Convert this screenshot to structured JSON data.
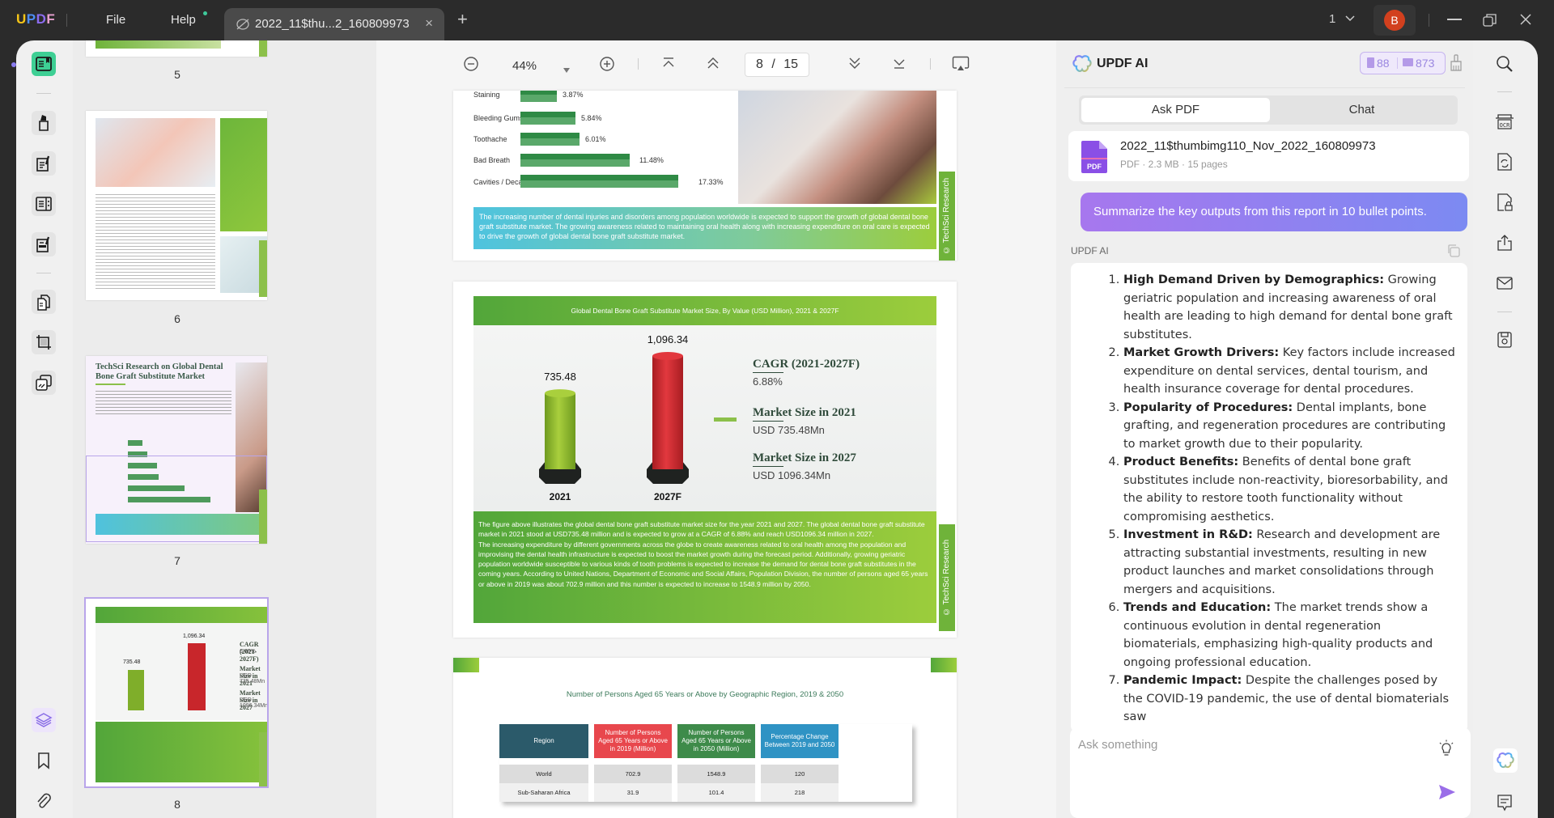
{
  "titlebar": {
    "app_name": "UPDF",
    "menus": [
      "File",
      "Help"
    ],
    "tab_title": "2022_11$thu...2_160809973",
    "close_tab": "×",
    "new_tab": "+",
    "window_count": "1",
    "avatar_initial": "B"
  },
  "left_toolbar": {
    "tools": [
      "reader-icon",
      "highlighter-icon",
      "edit-pdf-icon",
      "organize-pages-icon",
      "fill-sign-icon",
      "page-tools-icon",
      "crop-icon",
      "watermark-icon"
    ],
    "bottom": [
      "layers-icon",
      "bookmark-icon",
      "attachment-icon"
    ]
  },
  "thumbnails": {
    "pages": [
      {
        "number": "5"
      },
      {
        "number": "6"
      },
      {
        "number": "7",
        "title": "TechSci Research on Global Dental Bone Graft Substitute Market"
      },
      {
        "number": "8"
      }
    ],
    "selected_page": "8"
  },
  "viewer": {
    "zoom": "44%",
    "current_page": "8",
    "total_pages": "15",
    "page_separator": "/",
    "page7": {
      "bars": [
        {
          "label": "Staining",
          "value": "3.87%"
        },
        {
          "label": "Bleeding Gums",
          "value": "5.84%"
        },
        {
          "label": "Toothache",
          "value": "6.01%"
        },
        {
          "label": "Bad Breath",
          "value": "11.48%"
        },
        {
          "label": "Cavities / Decay",
          "value": "17.33%"
        }
      ],
      "callout": "The increasing number of dental injuries and disorders among population worldwide is expected to support the growth of global dental bone graft substitute market. The growing awareness related to maintaining oral health along with increasing expenditure on oral care is expected to drive the growth of global dental bone graft substitute market.",
      "watermark": "© TechSci Research"
    },
    "page8": {
      "chart_title": "Global Dental Bone Graft Substitute Market Size, By Value (USD Million), 2021 & 2027F",
      "bars": [
        {
          "year": "2021",
          "value": "735.48",
          "num": 735.48
        },
        {
          "year": "2027F",
          "value": "1,096.34",
          "num": 1096.34
        }
      ],
      "stats": [
        {
          "title": "CAGR (2021-2027F)",
          "value": "6.88%"
        },
        {
          "title": "Market Size in 2021",
          "value": "USD 735.48Mn"
        },
        {
          "title": "Market Size in 2027",
          "value": "USD 1096.34Mn"
        }
      ],
      "description_1": "The figure above illustrates the global dental bone graft substitute market size for the year 2021 and 2027. The global dental bone graft substitute market in 2021 stood at USD735.48 million and is expected to grow at a CAGR of 6.88% and reach USD1096.34 million in 2027.",
      "description_2": "The increasing expenditure by different governments across the globe to create awareness related to oral health among the population and improvising the dental health infrastructure is expected to boost the market growth during the forecast period. Additionally, growing geriatric population worldwide susceptible to various kinds of tooth problems is expected to increase the demand for dental bone graft substitutes in the coming years. According to United Nations, Department of Economic and Social Affairs, Population Division, the number of persons aged 65 years or above in 2019 was about 702.9 million and this number is expected to increase to 1548.9 million by 2050.",
      "watermark": "© TechSci Research"
    },
    "page9": {
      "table_title": "Number of Persons Aged 65 Years or Above by Geographic Region, 2019 & 2050",
      "headers": [
        "Region",
        "Number of Persons Aged 65 Years or Above in 2019 (Million)",
        "Number of Persons Aged 65 Years or Above in 2050 (Million)",
        "Percentage Change Between 2019 and 2050"
      ],
      "rows": [
        [
          "World",
          "702.9",
          "1548.9",
          "120"
        ],
        [
          "Sub-Saharan Africa",
          "31.9",
          "101.4",
          "218"
        ]
      ]
    }
  },
  "ai_panel": {
    "title": "UPDF AI",
    "credits_docs": "88",
    "credits_chat": "873",
    "tabs": [
      "Ask PDF",
      "Chat"
    ],
    "active_tab": "Ask PDF",
    "file": {
      "name": "2022_11$thumbimg110_Nov_2022_160809973",
      "meta": "PDF · 2.3 MB · 15 pages",
      "badge": "PDF"
    },
    "prompt": "Summarize the key outputs from this report in 10 bullet points.",
    "response_label": "UPDF AI",
    "response_items": [
      {
        "title": "High Demand Driven by Demographics:",
        "text": " Growing geriatric population and increasing awareness of oral health are leading to high demand for dental bone graft substitutes."
      },
      {
        "title": "Market Growth Drivers:",
        "text": " Key factors include increased expenditure on dental services, dental tourism, and health insurance coverage for dental procedures."
      },
      {
        "title": "Popularity of Procedures:",
        "text": " Dental implants, bone grafting, and regeneration procedures are contributing to market growth due to their popularity."
      },
      {
        "title": "Product Benefits:",
        "text": " Benefits of dental bone graft substitutes include non-reactivity, bioresorbability, and the ability to restore tooth functionality without compromising aesthetics."
      },
      {
        "title": "Investment in R&D:",
        "text": " Research and development are attracting substantial investments, resulting in new product launches and market consolidations through mergers and acquisitions."
      },
      {
        "title": "Trends and Education:",
        "text": " The market trends show a continuous evolution in dental regeneration biomaterials, emphasizing high-quality products and ongoing professional education."
      },
      {
        "title": "Pandemic Impact:",
        "text": " Despite the challenges posed by the COVID-19 pandemic, the use of dental biomaterials saw"
      }
    ],
    "input_placeholder": "Ask something"
  },
  "right_toolbar": {
    "tools": [
      "search-icon",
      "ocr-icon",
      "convert-icon",
      "protect-icon",
      "share-icon",
      "email-icon",
      "save-icon"
    ],
    "bottom": [
      "updf-ai-icon",
      "comment-icon"
    ]
  },
  "colors": {
    "accent_green": "#3ecf94",
    "ai_purple": "#a777ee",
    "techsci_green": "#6fb33a",
    "bar_red": "#c8262b",
    "bar_lime": "#8ab52a"
  }
}
